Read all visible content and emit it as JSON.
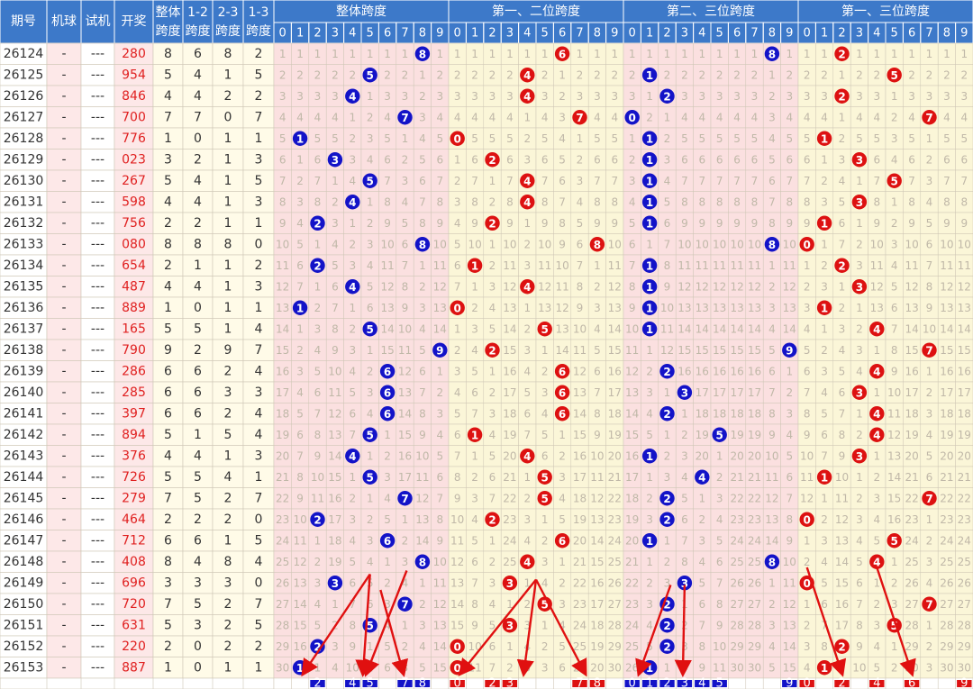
{
  "header": {
    "period_label": "期号",
    "machine_label": "机球",
    "test_label": "试机",
    "draw_label": "开奖",
    "total_span_label": [
      "整体",
      "跨度"
    ],
    "span12_label": [
      "1-2",
      "跨度"
    ],
    "span23_label": [
      "2-3",
      "跨度"
    ],
    "span13_label": [
      "1-3",
      "跨度"
    ],
    "group_titles": [
      "整体跨度",
      "第一、二位跨度",
      "第二、三位跨度",
      "第一、三位跨度"
    ],
    "digits": [
      "0",
      "1",
      "2",
      "3",
      "4",
      "5",
      "6",
      "7",
      "8",
      "9"
    ]
  },
  "colors": {
    "header_bg": "#3d79c9",
    "header_border": "#ffffff",
    "blue_ball": "#1313c8",
    "red_ball": "#dd1111",
    "blue_cell_bg": "#fbe0e0",
    "yellow_cell_bg": "#fbf6d8",
    "draw_text": "#e02020",
    "grid": "#cfc7b6",
    "miss_text": "#c0b8a8",
    "arrow": "#e01010"
  },
  "chart_data": {
    "type": "table",
    "rows": [
      {
        "period": "26124",
        "machine": "-",
        "test": "---",
        "draw": "280",
        "total": 8,
        "s12": 6,
        "s23": 8,
        "s13": 2
      },
      {
        "period": "26125",
        "machine": "-",
        "test": "---",
        "draw": "954",
        "total": 5,
        "s12": 4,
        "s23": 1,
        "s13": 5
      },
      {
        "period": "26126",
        "machine": "-",
        "test": "---",
        "draw": "846",
        "total": 4,
        "s12": 4,
        "s23": 2,
        "s13": 2
      },
      {
        "period": "26127",
        "machine": "-",
        "test": "---",
        "draw": "700",
        "total": 7,
        "s12": 7,
        "s23": 0,
        "s13": 7
      },
      {
        "period": "26128",
        "machine": "-",
        "test": "---",
        "draw": "776",
        "total": 1,
        "s12": 0,
        "s23": 1,
        "s13": 1
      },
      {
        "period": "26129",
        "machine": "-",
        "test": "---",
        "draw": "023",
        "total": 3,
        "s12": 2,
        "s23": 1,
        "s13": 3
      },
      {
        "period": "26130",
        "machine": "-",
        "test": "---",
        "draw": "267",
        "total": 5,
        "s12": 4,
        "s23": 1,
        "s13": 5
      },
      {
        "period": "26131",
        "machine": "-",
        "test": "---",
        "draw": "598",
        "total": 4,
        "s12": 4,
        "s23": 1,
        "s13": 3
      },
      {
        "period": "26132",
        "machine": "-",
        "test": "---",
        "draw": "756",
        "total": 2,
        "s12": 2,
        "s23": 1,
        "s13": 1
      },
      {
        "period": "26133",
        "machine": "-",
        "test": "---",
        "draw": "080",
        "total": 8,
        "s12": 8,
        "s23": 8,
        "s13": 0
      },
      {
        "period": "26134",
        "machine": "-",
        "test": "---",
        "draw": "654",
        "total": 2,
        "s12": 1,
        "s23": 1,
        "s13": 2
      },
      {
        "period": "26135",
        "machine": "-",
        "test": "---",
        "draw": "487",
        "total": 4,
        "s12": 4,
        "s23": 1,
        "s13": 3
      },
      {
        "period": "26136",
        "machine": "-",
        "test": "---",
        "draw": "889",
        "total": 1,
        "s12": 0,
        "s23": 1,
        "s13": 1
      },
      {
        "period": "26137",
        "machine": "-",
        "test": "---",
        "draw": "165",
        "total": 5,
        "s12": 5,
        "s23": 1,
        "s13": 4
      },
      {
        "period": "26138",
        "machine": "-",
        "test": "---",
        "draw": "790",
        "total": 9,
        "s12": 2,
        "s23": 9,
        "s13": 7
      },
      {
        "period": "26139",
        "machine": "-",
        "test": "---",
        "draw": "286",
        "total": 6,
        "s12": 6,
        "s23": 2,
        "s13": 4
      },
      {
        "period": "26140",
        "machine": "-",
        "test": "---",
        "draw": "285",
        "total": 6,
        "s12": 6,
        "s23": 3,
        "s13": 3
      },
      {
        "period": "26141",
        "machine": "-",
        "test": "---",
        "draw": "397",
        "total": 6,
        "s12": 6,
        "s23": 2,
        "s13": 4
      },
      {
        "period": "26142",
        "machine": "-",
        "test": "---",
        "draw": "894",
        "total": 5,
        "s12": 1,
        "s23": 5,
        "s13": 4
      },
      {
        "period": "26143",
        "machine": "-",
        "test": "---",
        "draw": "376",
        "total": 4,
        "s12": 4,
        "s23": 1,
        "s13": 3
      },
      {
        "period": "26144",
        "machine": "-",
        "test": "---",
        "draw": "726",
        "total": 5,
        "s12": 5,
        "s23": 4,
        "s13": 1
      },
      {
        "period": "26145",
        "machine": "-",
        "test": "---",
        "draw": "279",
        "total": 7,
        "s12": 5,
        "s23": 2,
        "s13": 7
      },
      {
        "period": "26146",
        "machine": "-",
        "test": "---",
        "draw": "464",
        "total": 2,
        "s12": 2,
        "s23": 2,
        "s13": 0
      },
      {
        "period": "26147",
        "machine": "-",
        "test": "---",
        "draw": "712",
        "total": 6,
        "s12": 6,
        "s23": 1,
        "s13": 5
      },
      {
        "period": "26148",
        "machine": "-",
        "test": "---",
        "draw": "408",
        "total": 8,
        "s12": 4,
        "s23": 8,
        "s13": 4
      },
      {
        "period": "26149",
        "machine": "-",
        "test": "---",
        "draw": "696",
        "total": 3,
        "s12": 3,
        "s23": 3,
        "s13": 0
      },
      {
        "period": "26150",
        "machine": "-",
        "test": "---",
        "draw": "720",
        "total": 7,
        "s12": 5,
        "s23": 2,
        "s13": 7
      },
      {
        "period": "26151",
        "machine": "-",
        "test": "---",
        "draw": "631",
        "total": 5,
        "s12": 3,
        "s23": 2,
        "s13": 5
      },
      {
        "period": "26152",
        "machine": "-",
        "test": "---",
        "draw": "220",
        "total": 2,
        "s12": 0,
        "s23": 2,
        "s13": 2
      },
      {
        "period": "26153",
        "machine": "-",
        "test": "---",
        "draw": "887",
        "total": 1,
        "s12": 0,
        "s23": 1,
        "s13": 1
      }
    ],
    "predictions": {
      "total": [
        2,
        4,
        5,
        7,
        8
      ],
      "s12": [
        0,
        2,
        3,
        7,
        8
      ],
      "s23": [
        0,
        1,
        2,
        3,
        4,
        5,
        9
      ],
      "s13": [
        0,
        2,
        4,
        6,
        9
      ]
    }
  }
}
